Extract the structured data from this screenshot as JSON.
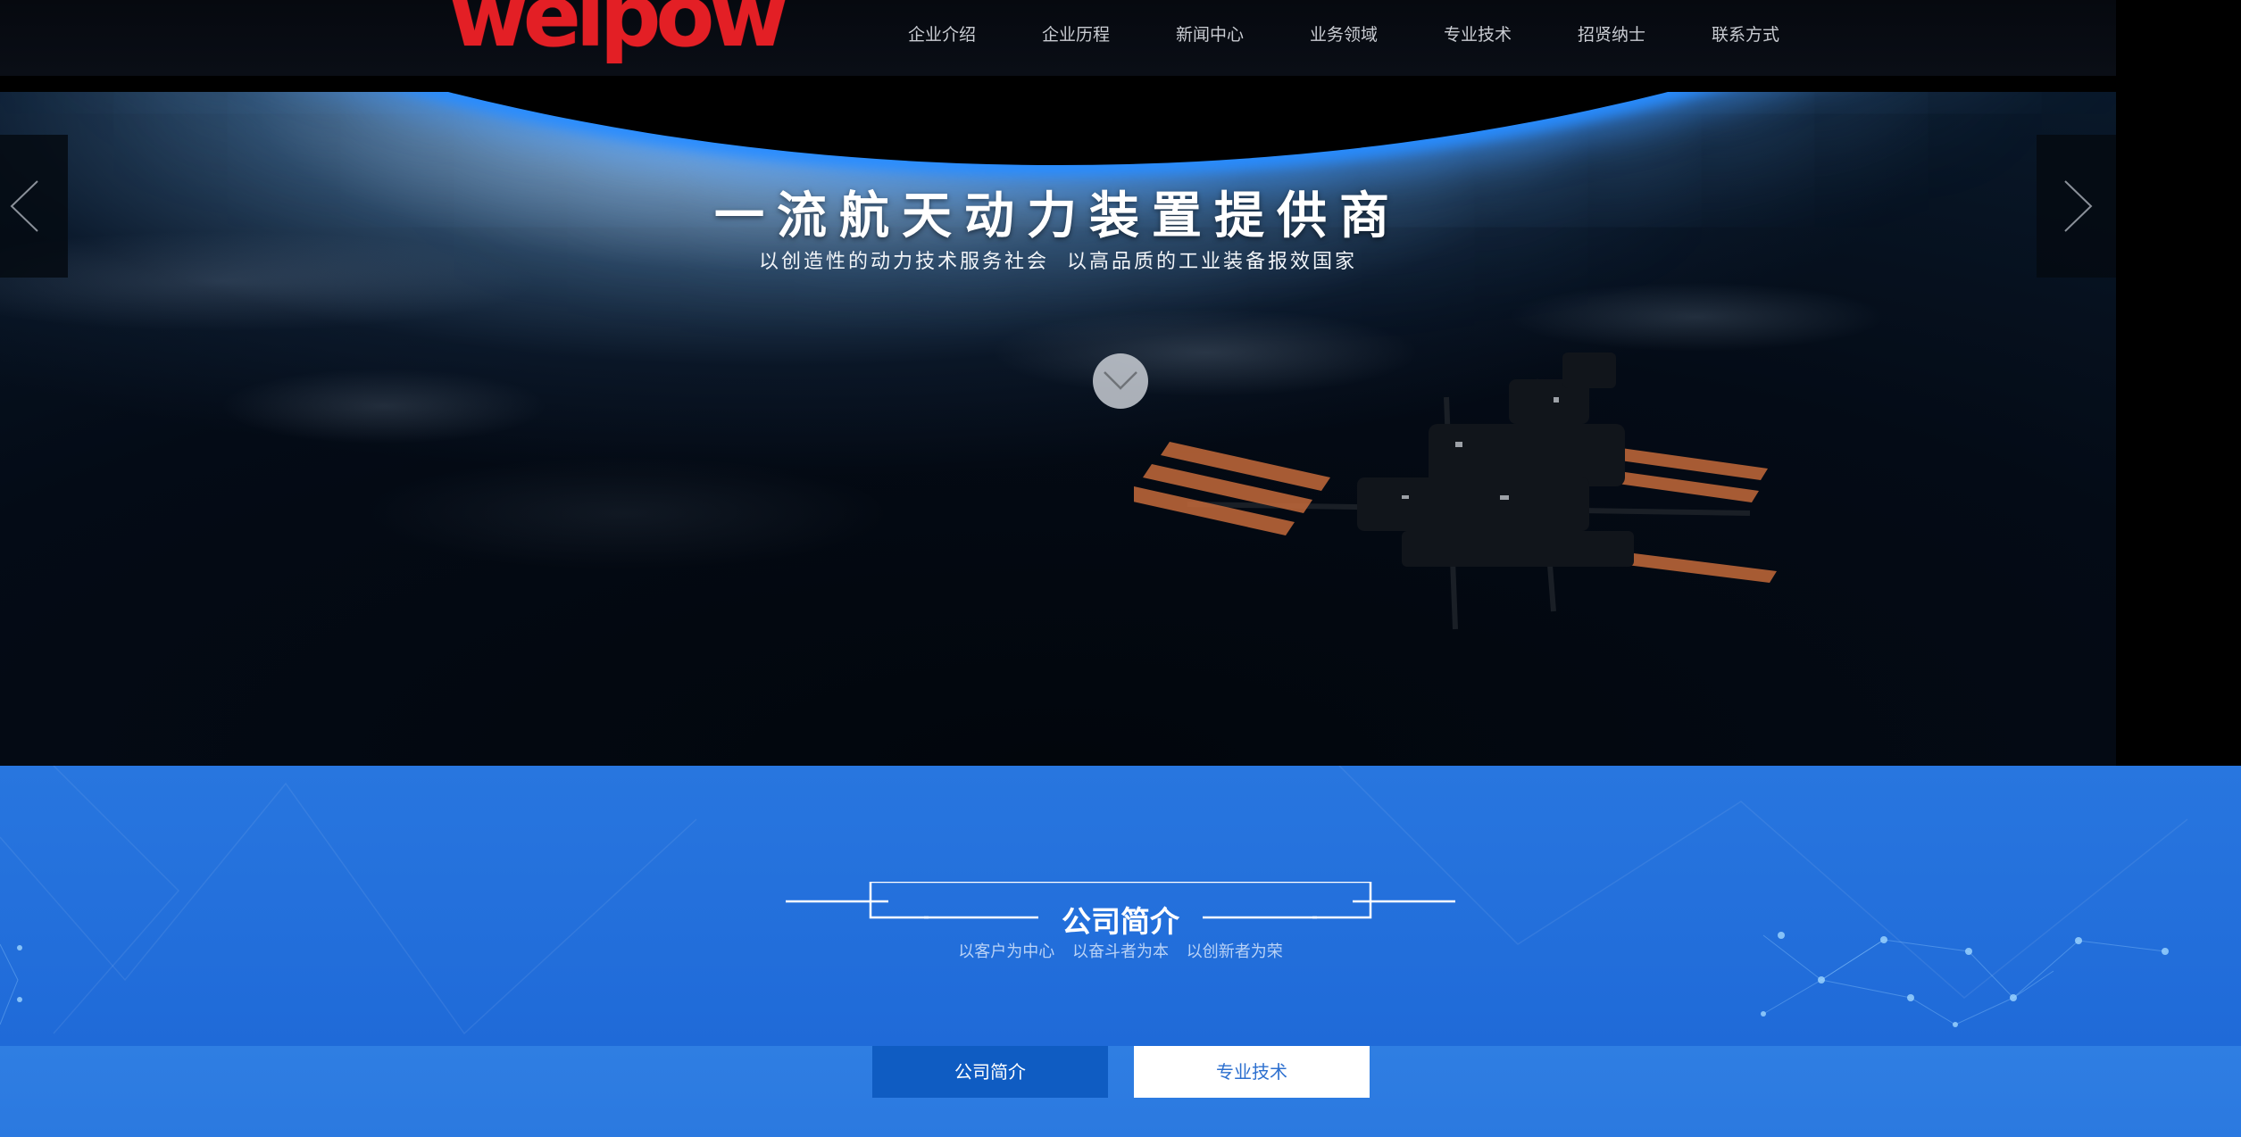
{
  "brand": {
    "logo_text": "weipow",
    "logo_color": "#e31f25"
  },
  "nav": {
    "items": [
      {
        "label": "企业介绍"
      },
      {
        "label": "企业历程"
      },
      {
        "label": "新闻中心"
      },
      {
        "label": "业务领域"
      },
      {
        "label": "专业技术"
      },
      {
        "label": "招贤纳士"
      },
      {
        "label": "联系方式"
      }
    ]
  },
  "hero": {
    "title": "一流航天动力装置提供商",
    "subtitle": "以创造性的动力技术服务社会  以高品质的工业装备报效国家",
    "icons": {
      "prev": "chevron-left-icon",
      "next": "chevron-right-icon",
      "scroll": "chevron-down-icon"
    }
  },
  "about": {
    "title": "公司简介",
    "subtitle": "以客户为中心  以奋斗者为本  以创新者为荣",
    "accent_color": "#2876df"
  },
  "tabs": {
    "active_label": "公司简介",
    "inactive_label": "专业技术"
  }
}
